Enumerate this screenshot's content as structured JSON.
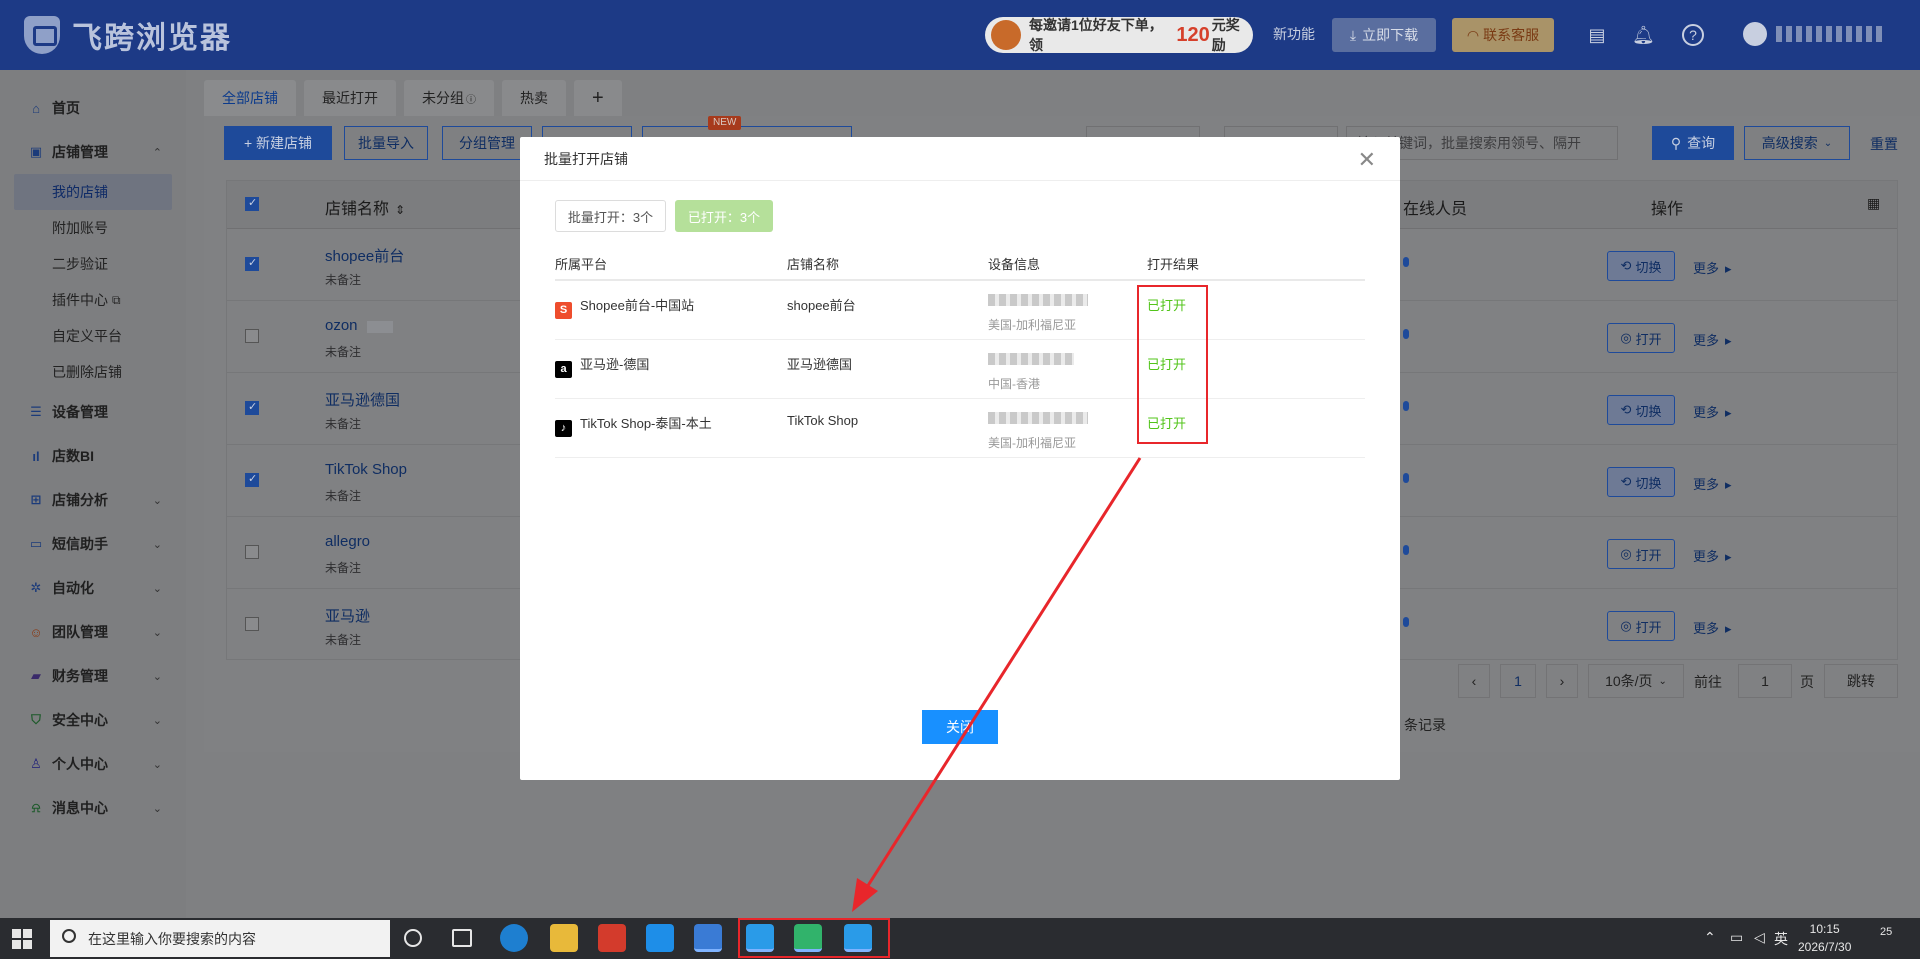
{
  "header": {
    "logo_text": "飞跨浏览器",
    "promo_prefix": "每邀请1位好友下单，领",
    "promo_amount": "120",
    "promo_suffix": "元奖励",
    "new_feature": "新功能",
    "download": "立即下载",
    "service": "联系客服"
  },
  "sidebar": {
    "home": "首页",
    "shop_mgmt": "店铺管理",
    "sub": [
      "我的店铺",
      "附加账号",
      "二步验证",
      "插件中心",
      "自定义平台",
      "已删除店铺"
    ],
    "device_mgmt": "设备管理",
    "bi": "店数BI",
    "analysis": "店铺分析",
    "sms": "短信助手",
    "auto": "自动化",
    "team": "团队管理",
    "finance": "财务管理",
    "security": "安全中心",
    "personal": "个人中心",
    "message": "消息中心"
  },
  "tabs": [
    "全部店铺",
    "最近打开",
    "未分组",
    "热卖",
    "+"
  ],
  "toolbar": {
    "new_shop": "+ 新建店铺",
    "batch_import": "批量导入",
    "group_mgmt": "分组管理",
    "new_badge": "NEW",
    "search_placeholder": "输入关键词，批量搜索用领号、隔开",
    "query": "查询",
    "advanced": "高级搜索",
    "reset": "重置"
  },
  "grid": {
    "col_name": "店铺名称",
    "col_online": "在线人员",
    "col_action": "操作",
    "rows": [
      {
        "name": "shopee前台",
        "note": "未备注",
        "checked": true,
        "action": "切换"
      },
      {
        "name": "ozon",
        "note": "未备注",
        "checked": false,
        "action": "打开"
      },
      {
        "name": "亚马逊德国",
        "note": "未备注",
        "checked": true,
        "action": "切换"
      },
      {
        "name": "TikTok Shop",
        "note": "未备注",
        "checked": true,
        "action": "切换"
      },
      {
        "name": "allegro",
        "note": "未备注",
        "checked": false,
        "action": "打开"
      },
      {
        "name": "亚马逊",
        "note": "未备注",
        "checked": false,
        "action": "打开"
      }
    ],
    "more": "更多"
  },
  "pager": {
    "records_suffix": "条记录",
    "page": "1",
    "per_page": "10条/页",
    "goto": "前往",
    "goto_value": "1",
    "page_unit": "页",
    "jump": "跳转"
  },
  "dialog": {
    "title": "批量打开店铺",
    "batch_open": "批量打开：3个",
    "opened_count": "已打开：3个",
    "headers": [
      "所属平台",
      "店铺名称",
      "设备信息",
      "打开结果"
    ],
    "rows": [
      {
        "platform": "Shopee前台-中国站",
        "shop": "shopee前台",
        "region": "美国-加利福尼亚",
        "result": "已打开",
        "icon": "S",
        "icon_color": "#ee4d2d"
      },
      {
        "platform": "亚马逊-德国",
        "shop": "亚马逊德国",
        "region": "中国-香港",
        "result": "已打开",
        "icon": "a",
        "icon_color": "#000000"
      },
      {
        "platform": "TikTok Shop-泰国-本土",
        "shop": "TikTok Shop",
        "region": "美国-加利福尼亚",
        "result": "已打开",
        "icon": "♪",
        "icon_color": "#000000"
      }
    ],
    "close": "关闭"
  },
  "taskbar": {
    "search_placeholder": "在这里输入你要搜索的内容",
    "ime": "英",
    "time": "10:15",
    "date": "2026/7/30",
    "notif": "25"
  },
  "colors": {
    "header_bg": "#1d3a86",
    "primary": "#1890ff",
    "success": "#52c41a",
    "annotation": "#e8262b"
  }
}
